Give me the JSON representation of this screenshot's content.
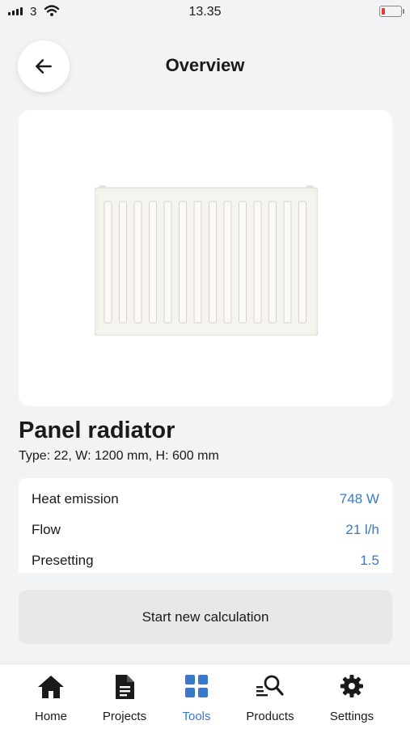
{
  "status": {
    "carrier": "3",
    "time": "13.35"
  },
  "header": {
    "title": "Overview"
  },
  "product": {
    "name": "Panel radiator",
    "spec": "Type: 22, W: 1200 mm, H: 600 mm"
  },
  "results": [
    {
      "label": "Heat emission",
      "value": "748 W"
    },
    {
      "label": "Flow",
      "value": "21 l/h"
    },
    {
      "label": "Presetting",
      "value": "1.5"
    }
  ],
  "actions": {
    "start_new": "Start new calculation"
  },
  "tabs": [
    {
      "label": "Home",
      "icon": "home-icon"
    },
    {
      "label": "Projects",
      "icon": "document-icon"
    },
    {
      "label": "Tools",
      "icon": "grid-icon",
      "active": true
    },
    {
      "label": "Products",
      "icon": "search-list-icon"
    },
    {
      "label": "Settings",
      "icon": "gear-icon"
    }
  ],
  "colors": {
    "accent": "#3a79c9",
    "background": "#f2f3f5",
    "battery_low": "#e53935"
  }
}
